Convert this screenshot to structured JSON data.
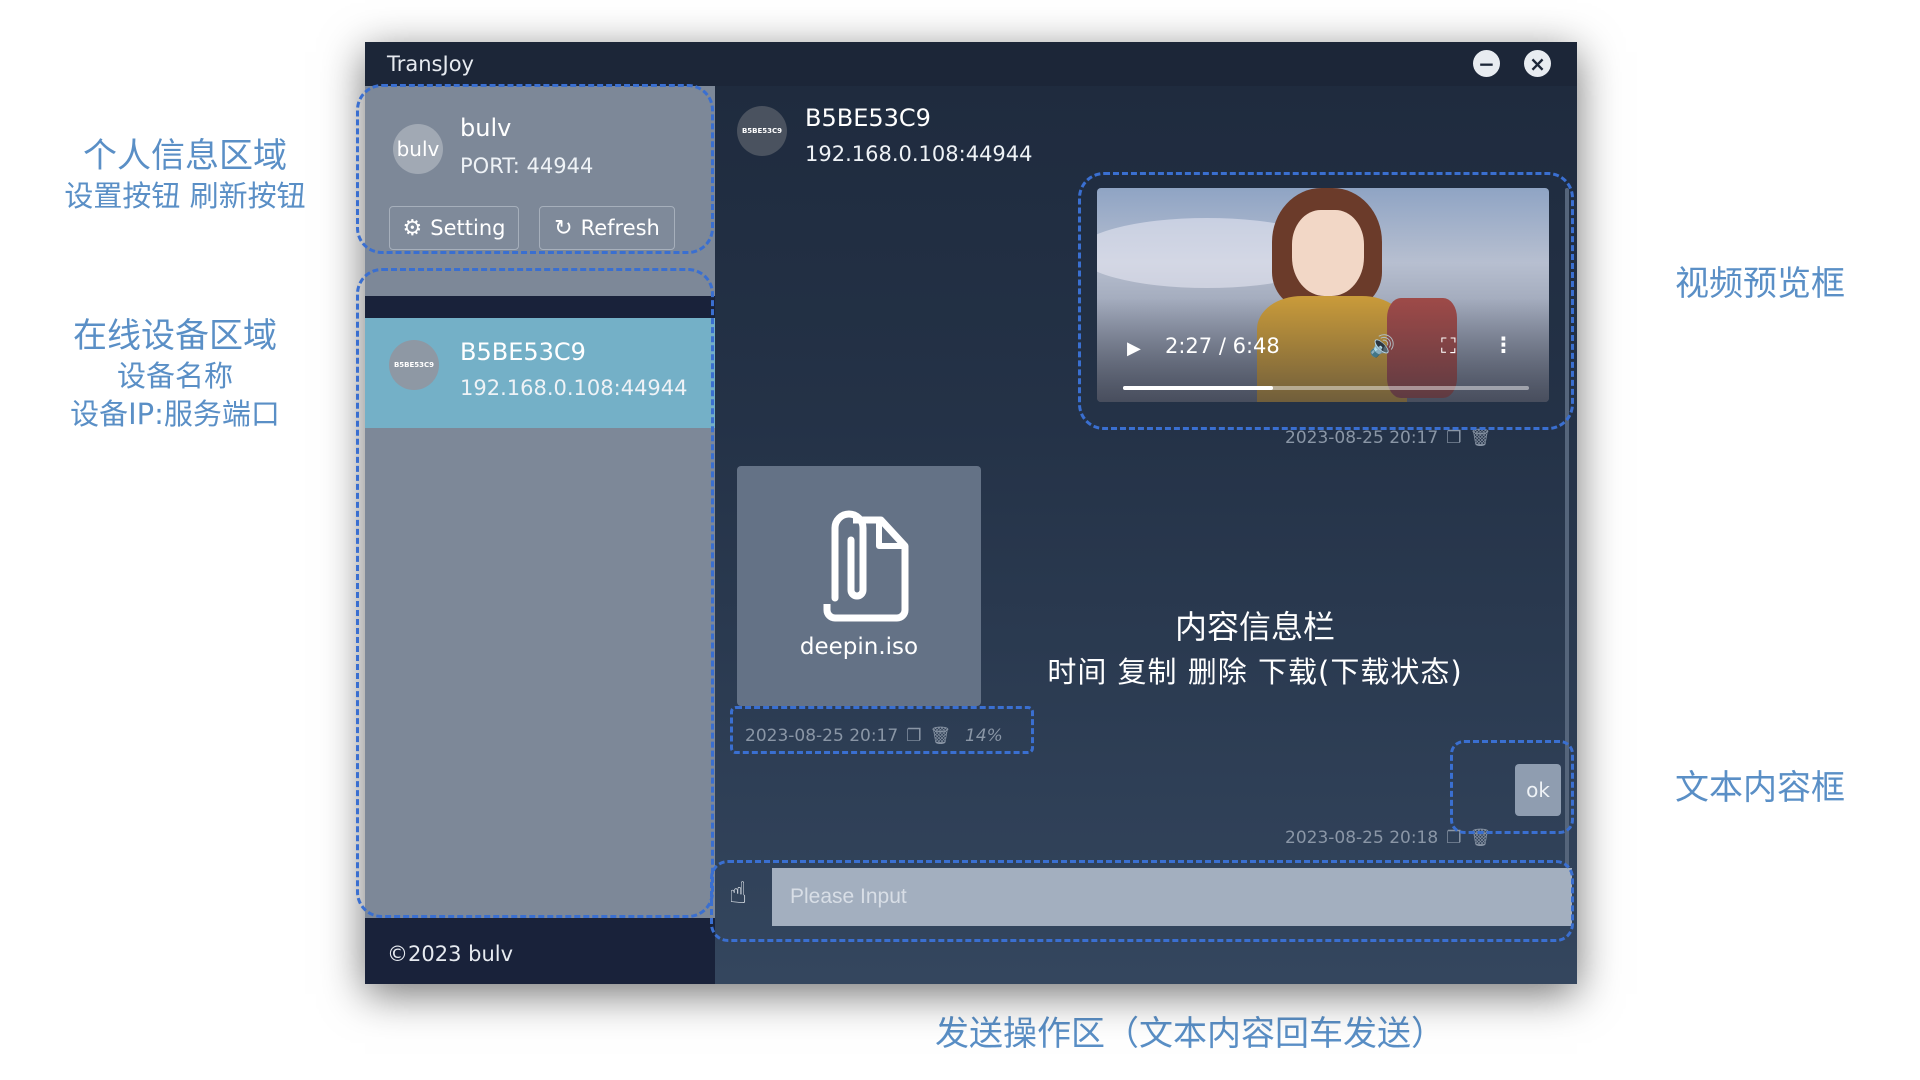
{
  "app": {
    "title": "TransJoy",
    "copyright": "©2023 bulv"
  },
  "profile": {
    "avatar_text": "bulv",
    "name": "bulv",
    "port": "PORT: 44944",
    "setting_label": "Setting",
    "refresh_label": "Refresh"
  },
  "devices": [
    {
      "avatar_text": "B5BE53C9",
      "name": "B5BE53C9",
      "ip": "192.168.0.108:44944",
      "selected": true
    }
  ],
  "chat": {
    "peer_avatar_text": "B5BE53C9",
    "peer_name": "B5BE53C9",
    "peer_ip": "192.168.0.108:44944",
    "video": {
      "time": "2:27 / 6:48",
      "progress": 0.37
    },
    "video_meta_time": "2023-08-25 20:17",
    "file": {
      "name": "deepin.iso",
      "time": "2023-08-25 20:17",
      "progress_text": "14%"
    },
    "text_message": {
      "text": "ok",
      "time": "2023-08-25 20:18"
    },
    "input_placeholder": "Please Input"
  },
  "annotations": {
    "profile_area": "个人信息区域",
    "profile_buttons": "设置按钮  刷新按钮",
    "online_devices": "在线设备区域",
    "device_name": "设备名称",
    "device_ip_port": "设备IP:服务端口",
    "video_preview": "视频预览框",
    "text_box": "文本内容框",
    "content_info_title": "内容信息栏",
    "content_info_items": "时间  复制  删除  下载(下载状态)",
    "send_area": "发送操作区（文本内容回车发送）"
  },
  "colors": {
    "annotation_text": "#5a8fc6",
    "annotation_outline": "#3a6fd0",
    "selected_device": "#74b0c7",
    "panel_gray": "#7d8898"
  },
  "icons": {
    "setting": "gear-icon",
    "refresh": "refresh-icon",
    "minimize": "minimize-icon",
    "close": "close-icon",
    "file": "file-attachment-icon",
    "attach": "hand-pointer-icon",
    "copy": "copy-icon",
    "delete": "trash-icon"
  }
}
